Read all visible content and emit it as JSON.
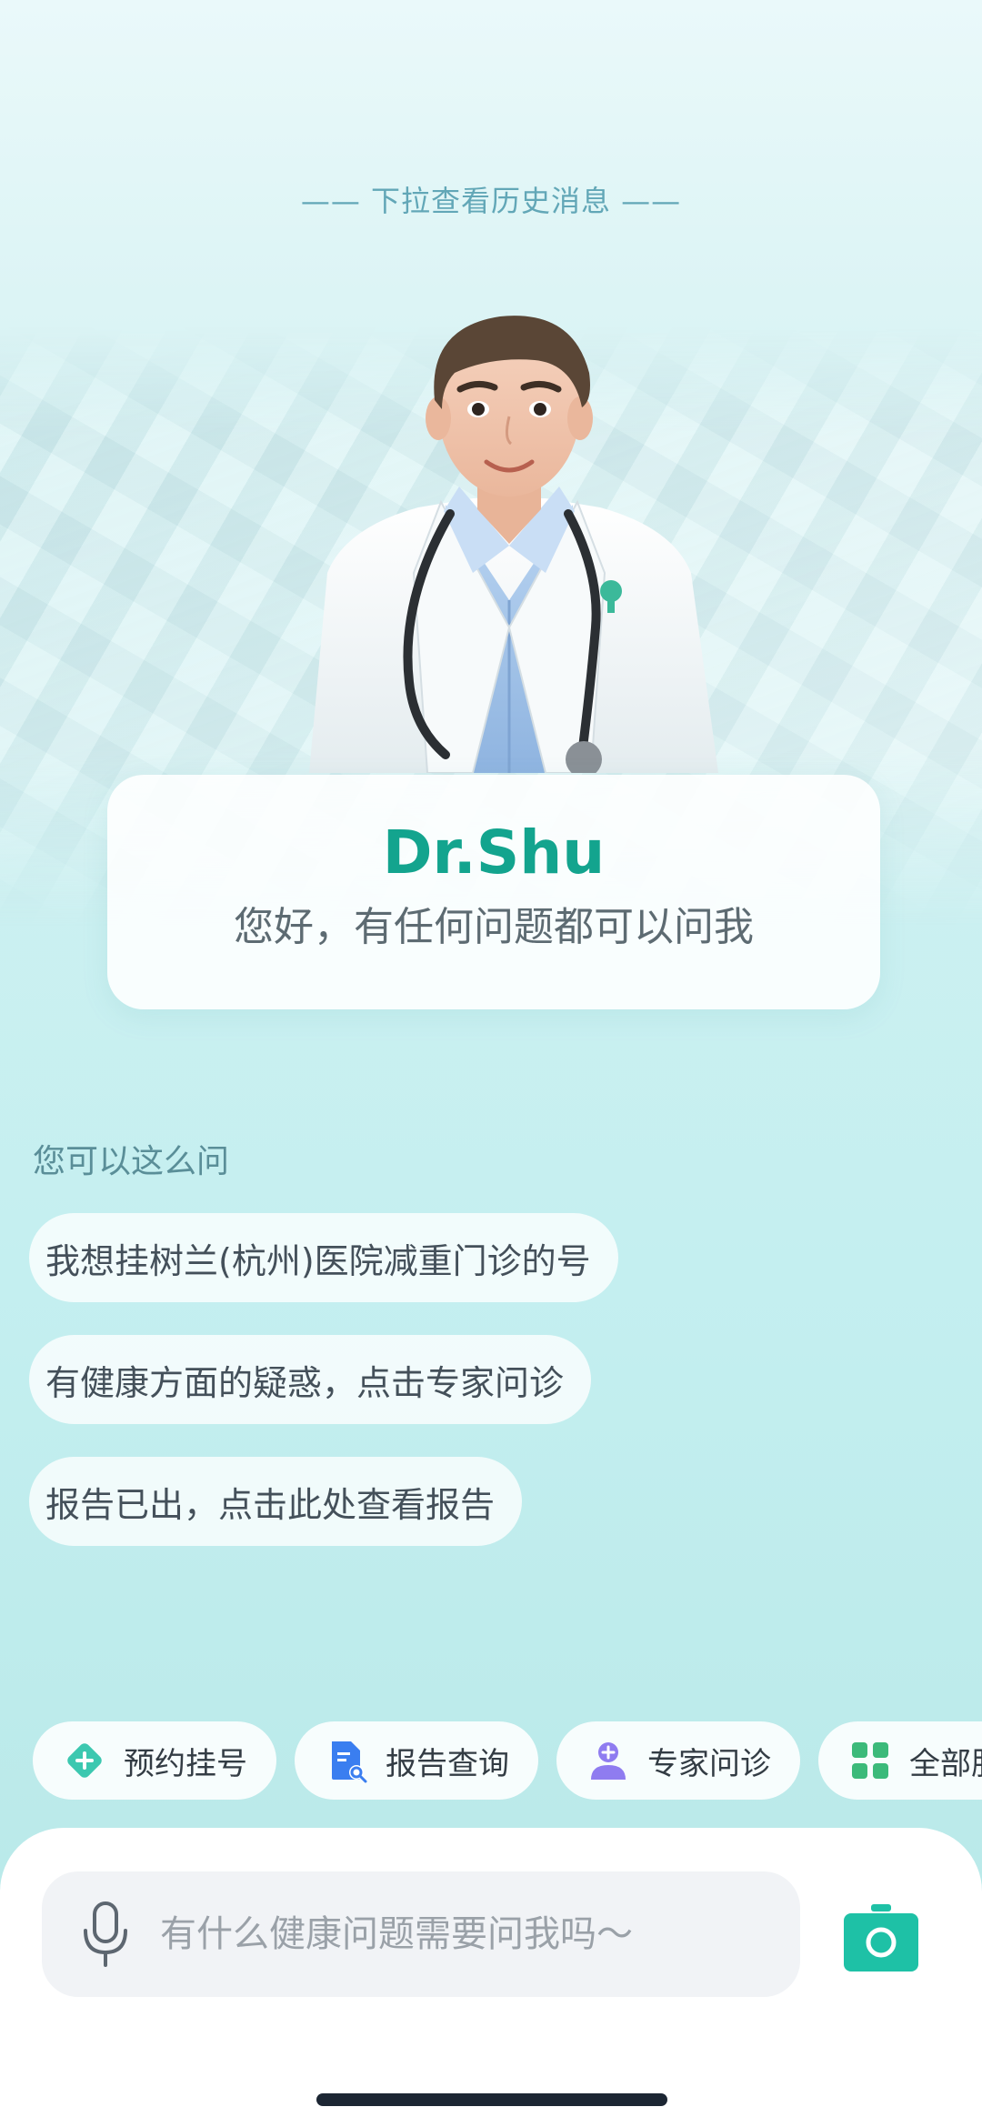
{
  "pull_hint": "—— 下拉查看历史消息 ——",
  "assistant": {
    "name": "Dr.Shu",
    "greeting": "您好，有任何问题都可以问我"
  },
  "suggestions": {
    "title": "您可以这么问",
    "items": [
      "我想挂树兰(杭州)医院减重门诊的号",
      "有健康方面的疑惑，点击专家问诊",
      "报告已出，点击此处查看报告"
    ]
  },
  "quick_actions": [
    {
      "label": "预约挂号",
      "icon": "register-icon",
      "color": "#3cc8b0"
    },
    {
      "label": "报告查询",
      "icon": "report-search-icon",
      "color": "#3a7ef0"
    },
    {
      "label": "专家问诊",
      "icon": "expert-consult-icon",
      "color": "#8f7cf0"
    },
    {
      "label": "全部服务",
      "icon": "all-services-icon",
      "color": "#3cba7a"
    }
  ],
  "input": {
    "placeholder": "有什么健康问题需要问我吗～"
  },
  "colors": {
    "brand": "#13a48e",
    "camera": "#1ec1a6"
  }
}
